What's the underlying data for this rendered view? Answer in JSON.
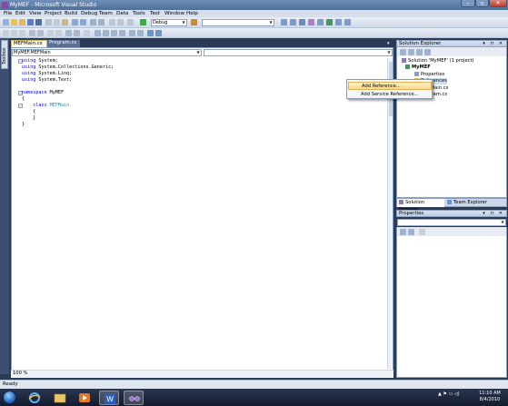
{
  "window": {
    "title": "MyMEF - Microsoft Visual Studio",
    "min": "–",
    "max": "▫",
    "close": "✕"
  },
  "menu": [
    "File",
    "Edit",
    "View",
    "Project",
    "Build",
    "Debug",
    "Team",
    "Data",
    "Tools",
    "Test",
    "Window",
    "Help"
  ],
  "toolbar": {
    "config": "Debug",
    "platform": ""
  },
  "toolbox": {
    "label": "Toolbox"
  },
  "tabs": {
    "active": "MEFMain.cs",
    "second": "Program.cs",
    "dropdown": "▾"
  },
  "navbar": {
    "left": "MyMEF.MEFMain",
    "right": ""
  },
  "code": {
    "l1_kw": "using",
    "l1_rest": " System;",
    "l2_kw": "using",
    "l2_rest": " System.Collections.Generic;",
    "l3_kw": "using",
    "l3_rest": " System.Linq;",
    "l4_kw": "using",
    "l4_rest": " System.Text;",
    "l6_kw": "namespace",
    "l6_rest": " MyMEF",
    "l7": "{",
    "l8_kw": "class",
    "l8_type": "MEFMain",
    "l9": "{",
    "l10": "}",
    "l11": "}"
  },
  "zoom": "100 %",
  "context_menu": {
    "add_reference": "Add Reference...",
    "add_service_reference": "Add Service Reference..."
  },
  "solution_explorer": {
    "title": "Solution Explorer",
    "solution": "Solution 'MyMEF' (1 project)",
    "project": "MyMEF",
    "properties": "Properties",
    "references": "References",
    "file1": "MEFMain.cs",
    "file2": "Program.cs",
    "header_buttons": "▾ ⊓ ✕"
  },
  "bottom_tabs": {
    "solution_explorer": "Solution Explorer",
    "team_explorer": "Team Explorer"
  },
  "properties_panel": {
    "title": "Properties",
    "header_buttons": "▾ ⊓ ✕"
  },
  "status": "Ready",
  "taskbar": {
    "time": "11:10 AM",
    "date": "8/4/2010",
    "tray": "▲ ⚑ ▭ ◁)"
  },
  "colors": {
    "keyword": "#0000ff",
    "type": "#2b91af",
    "titlebar": "#5a7aa6",
    "context_highlight": "#fbd98a"
  }
}
